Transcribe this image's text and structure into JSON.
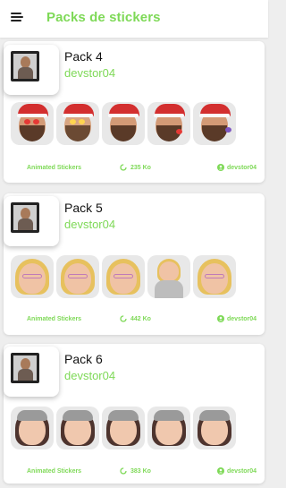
{
  "app": {
    "title": "Packs de stickers",
    "icons": {
      "menu": "menu-icon",
      "size": "refresh-icon",
      "author": "person-icon"
    },
    "accent_color": "#7ed957"
  },
  "packs": [
    {
      "name": "Pack 4",
      "author": "devstor04",
      "type_label": "Animated Stickers",
      "size": "235 Ko",
      "footer_author": "devstor04",
      "theme": "santa-hat"
    },
    {
      "name": "Pack 5",
      "author": "devstor04",
      "type_label": "Animated Stickers",
      "size": "442 Ko",
      "footer_author": "devstor04",
      "theme": "blonde-glasses"
    },
    {
      "name": "Pack 6",
      "author": "devstor04",
      "type_label": "Animated Stickers",
      "size": "383 Ko",
      "footer_author": "devstor04",
      "theme": "beret"
    }
  ]
}
